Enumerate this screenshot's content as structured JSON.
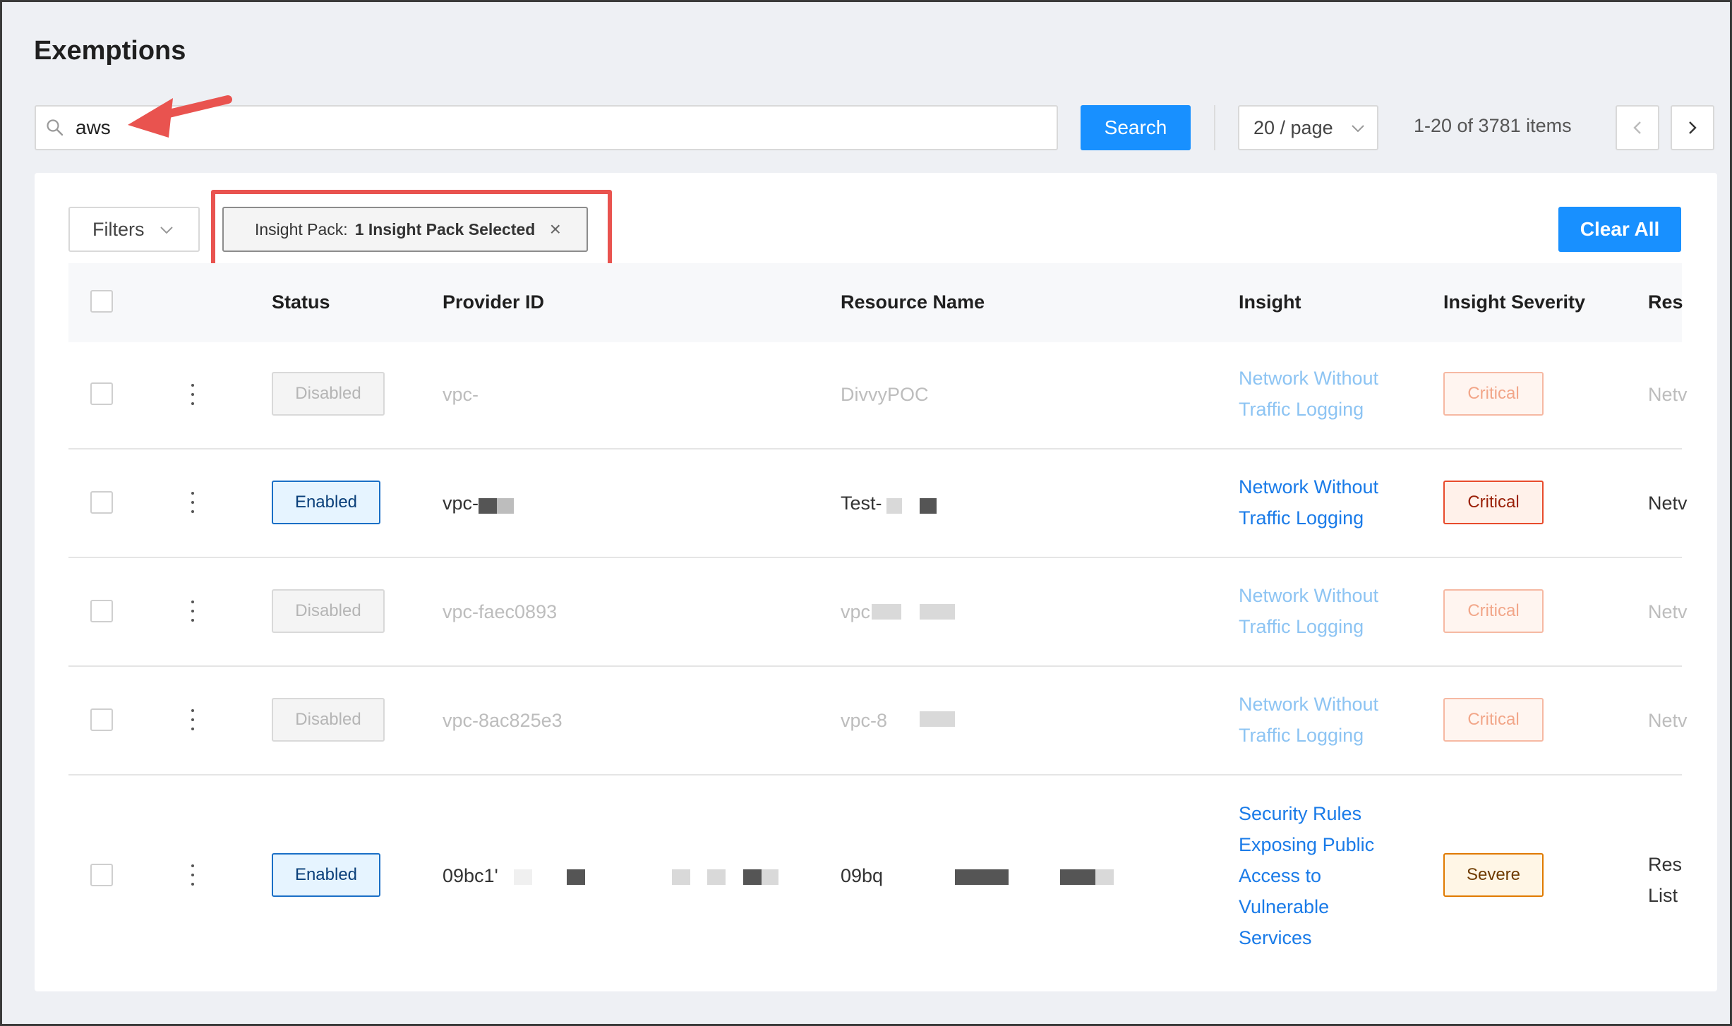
{
  "page": {
    "title": "Exemptions"
  },
  "search": {
    "value": "aws",
    "button_label": "Search"
  },
  "pagination": {
    "page_size": "20 / page",
    "items_text": "1-20 of 3781 items"
  },
  "filters": {
    "button_label": "Filters",
    "tag_key": "Insight Pack:",
    "tag_value": "1 Insight Pack Selected",
    "tag_close": "×",
    "clear_all_label": "Clear All"
  },
  "table": {
    "headers": {
      "status": "Status",
      "provider_id": "Provider ID",
      "resource_name": "Resource Name",
      "insight": "Insight",
      "insight_severity": "Insight Severity",
      "resource_type": "Res"
    },
    "rows": [
      {
        "status": "Disabled",
        "provider_id": "vpc-",
        "resource_name": "DivvyPOC",
        "insight_line1": "Network Without",
        "insight_line2": "Traffic Logging",
        "severity": "Critical",
        "resource_type": "Netv"
      },
      {
        "status": "Enabled",
        "provider_id": "vpc-",
        "resource_name": "Test-",
        "insight_line1": "Network Without",
        "insight_line2": "Traffic Logging",
        "severity": "Critical",
        "resource_type": "Netv"
      },
      {
        "status": "Disabled",
        "provider_id": "vpc-faec0893",
        "resource_name": "vpc",
        "insight_line1": "Network Without",
        "insight_line2": "Traffic Logging",
        "severity": "Critical",
        "resource_type": "Netv"
      },
      {
        "status": "Disabled",
        "provider_id": "vpc-8ac825e3",
        "resource_name": "vpc-8",
        "insight_line1": "Network Without",
        "insight_line2": "Traffic Logging",
        "severity": "Critical",
        "resource_type": "Netv"
      },
      {
        "status": "Enabled",
        "provider_id": "09bc1'",
        "resource_name": "09bq",
        "insight_lines": [
          "Security Rules",
          "Exposing Public",
          "Access to",
          "Vulnerable",
          "Services"
        ],
        "severity": "Severe",
        "resource_type_line1": "Res",
        "resource_type_line2": "List"
      }
    ]
  },
  "icons": {
    "search": "search-icon",
    "annotation": "red-arrow-icon",
    "chevron": "chevron-down-icon",
    "prev": "chevron-left-icon",
    "next": "chevron-right-icon",
    "kebab": "more-vertical-icon"
  },
  "colors": {
    "primary": "#1890ff",
    "annotation_red": "#e9534f",
    "link": "#1a7be8",
    "critical": "#e84b2c",
    "severe": "#e07a00"
  }
}
